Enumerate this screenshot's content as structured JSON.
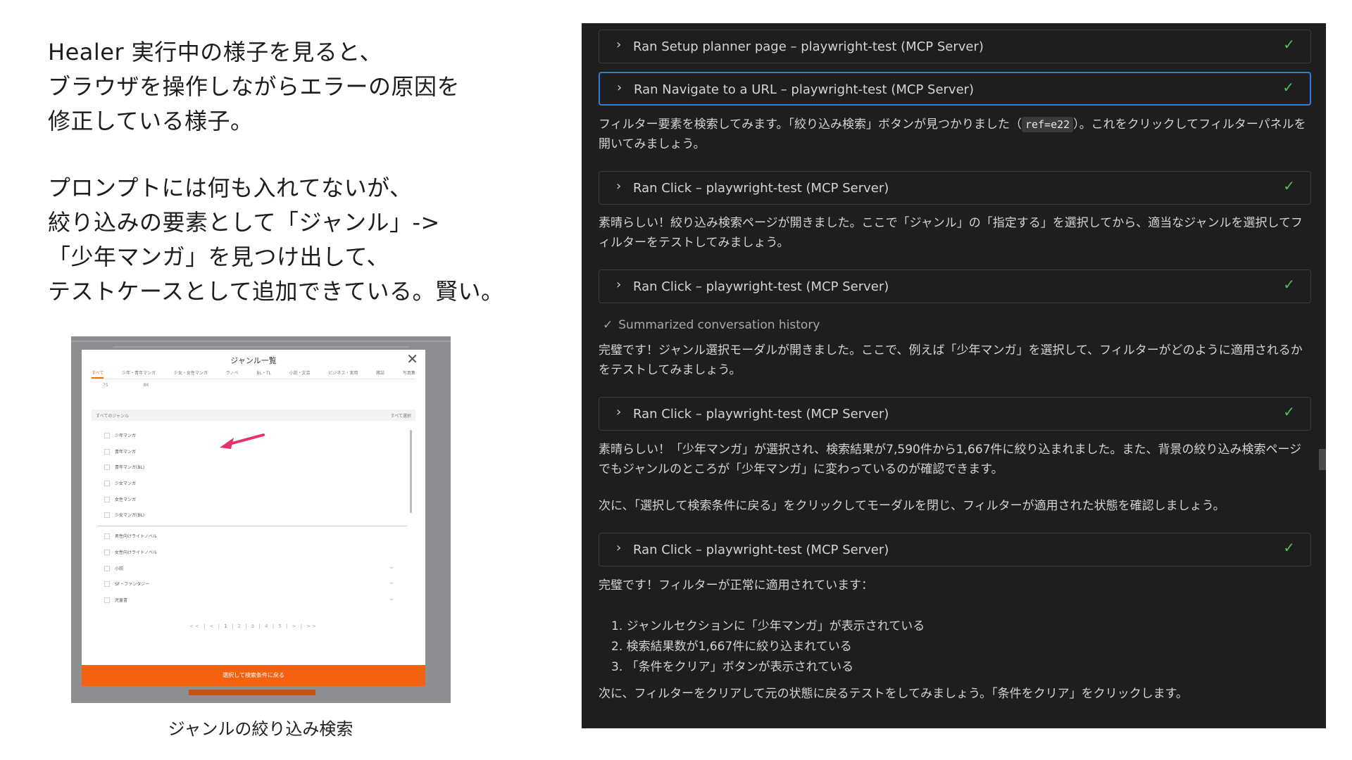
{
  "slide": {
    "caption_lines_1": [
      "Healer 実行中の様子を見ると、",
      "ブラウザを操作しながらエラーの原因を",
      "修正している様子。"
    ],
    "caption_lines_2": [
      "プロンプトには何も入れてないが、",
      "絞り込みの要素として「ジャンル」->",
      "「少年マンガ」を見つけ出して、",
      "テストケースとして追加できている。賢い。"
    ],
    "screenshot_caption": "ジャンルの絞り込み検索"
  },
  "modal": {
    "title": "ジャンル一覧",
    "close": "✕",
    "tabs": [
      "すべて",
      "少年・青年マンガ",
      "少女・女性マンガ",
      "ラノベ",
      "BL・TL",
      "小説・文芸",
      "ビジネス・実用",
      "雑誌",
      "写真集"
    ],
    "subtabs": [
      "75",
      "86"
    ],
    "list_head_left": "すべてのジャンル",
    "list_head_right": "すべて選択",
    "items_group1": [
      "少年マンガ",
      "青年マンガ",
      "青年マンガ(BL)"
    ],
    "items_group2": [
      "少女マンガ",
      "女性マンガ",
      "少女マンガ(BL)"
    ],
    "items_group3": [
      "男性向けライトノベル",
      "女性向けライトノベル"
    ],
    "items_group4": [
      "小説",
      "SF・ファンタジー",
      "児童書"
    ],
    "pager_prev": "<< | < |",
    "pager_current": "1",
    "pager_rest": "| 2 | 3 | 4 | 5 | > | >>",
    "cta": "選択して検索条件に戻る",
    "arrow_color": "#e8326e"
  },
  "chat": {
    "check_glyph": "✓",
    "chevron_glyph": "›",
    "tool1": "Ran Setup planner page – playwright-test (MCP Server)",
    "tool2": "Ran Navigate to a URL – playwright-test (MCP Server)",
    "msg1_before": "フィルター要素を検索してみます。「絞り込み検索」ボタンが見つかりました（",
    "msg1_code": "ref=e22",
    "msg1_after": "）。これをクリックしてフィルターパネルを開いてみましょう。",
    "tool3": "Ran Click – playwright-test (MCP Server)",
    "msg2": "素晴らしい！絞り込み検索ページが開きました。ここで「ジャンル」の「指定する」を選択してから、適当なジャンルを選択してフィルターをテストしてみましょう。",
    "tool4": "Ran Click – playwright-test (MCP Server)",
    "summary": "Summarized conversation history",
    "msg3": "完璧です！ジャンル選択モーダルが開きました。ここで、例えば「少年マンガ」を選択して、フィルターがどのように適用されるかをテストしてみましょう。",
    "tool5": "Ran Click – playwright-test (MCP Server)",
    "msg4": "素晴らしい！「少年マンガ」が選択され、検索結果が7,590件から1,667件に絞り込まれました。また、背景の絞り込み検索ページでもジャンルのところが「少年マンガ」に変わっているのが確認できます。",
    "msg5": "次に、「選択して検索条件に戻る」をクリックしてモーダルを閉じ、フィルターが適用された状態を確認しましょう。",
    "tool6": "Ran Click – playwright-test (MCP Server)",
    "msg6": "完璧です！フィルターが正常に適用されています：",
    "list": [
      "1. ジャンルセクションに「少年マンガ」が表示されている",
      "2. 検索結果数が1,667件に絞り込まれている",
      "3. 「条件をクリア」ボタンが表示されている"
    ],
    "msg7": "次に、フィルターをクリアして元の状態に戻るテストをしてみましょう。「条件をクリア」をクリックします。"
  }
}
